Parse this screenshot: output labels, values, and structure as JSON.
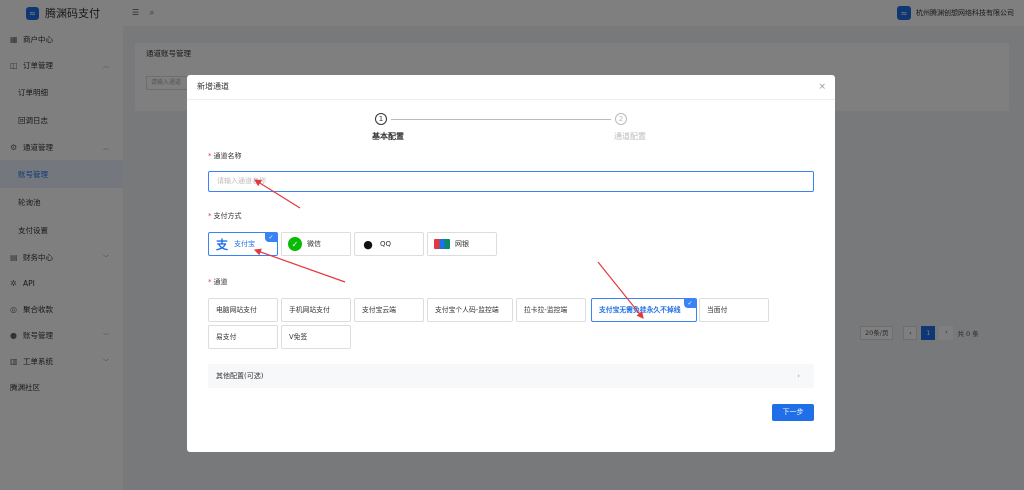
{
  "app": {
    "title": "腾渊码支付"
  },
  "header": {
    "company": "杭州腾渊创想网络科技有限公司"
  },
  "sidebar": {
    "items": [
      {
        "label": "商户中心",
        "icon": "grid-icon"
      },
      {
        "label": "订单管理",
        "icon": "cart-icon",
        "arrow": "^"
      },
      {
        "label": "订单明细",
        "sub": true
      },
      {
        "label": "回调日志",
        "sub": true
      },
      {
        "label": "通道管理",
        "icon": "settings-icon",
        "arrow": "^"
      },
      {
        "label": "账号管理",
        "sub": true,
        "active": true
      },
      {
        "label": "轮询池",
        "sub": true
      },
      {
        "label": "支付设置",
        "sub": true
      },
      {
        "label": "财务中心",
        "icon": "finance-icon",
        "arrow": "v"
      },
      {
        "label": "API",
        "icon": "gear-icon"
      },
      {
        "label": "聚合收款",
        "icon": "collect-icon"
      },
      {
        "label": "账号管理",
        "icon": "user-icon",
        "arrow": "v"
      },
      {
        "label": "工单系统",
        "icon": "ticket-icon",
        "arrow": "v"
      },
      {
        "label": "腾渊社区",
        "icon": ""
      }
    ]
  },
  "background": {
    "card_title": "通道账号管理",
    "search_placeholder": "请输入通道",
    "pager": {
      "page_size": "20条/页",
      "current_page": "1",
      "total": "共 0 条"
    }
  },
  "modal": {
    "title": "新增通道",
    "steps": [
      {
        "num": "1",
        "label": "基本配置"
      },
      {
        "num": "2",
        "label": "通道配置"
      }
    ],
    "name_field": {
      "label": "通道名称",
      "placeholder": "请输入通道名称"
    },
    "pay_method": {
      "label": "支付方式",
      "options": [
        {
          "label": "支付宝",
          "icon": "alipay-icon",
          "selected": true
        },
        {
          "label": "微信",
          "icon": "wechat-icon",
          "selected": false
        },
        {
          "label": "QQ",
          "icon": "qq-icon",
          "selected": false
        },
        {
          "label": "网银",
          "icon": "unionpay-icon",
          "selected": false
        }
      ]
    },
    "channel": {
      "label": "通道",
      "options": [
        "电脑网站支付",
        "手机网站支付",
        "支付宝云端",
        "支付宝个人码-监控端",
        "拉卡拉-监控端",
        "支付宝无需免挂永久不掉线",
        "当面付",
        "易支付",
        "V免签"
      ],
      "selected_index": 5
    },
    "other_config": "其他配置(可选)",
    "next_button": "下一步"
  },
  "colors": {
    "accent": "#1e6fe8",
    "annotation": "#e4393c"
  }
}
